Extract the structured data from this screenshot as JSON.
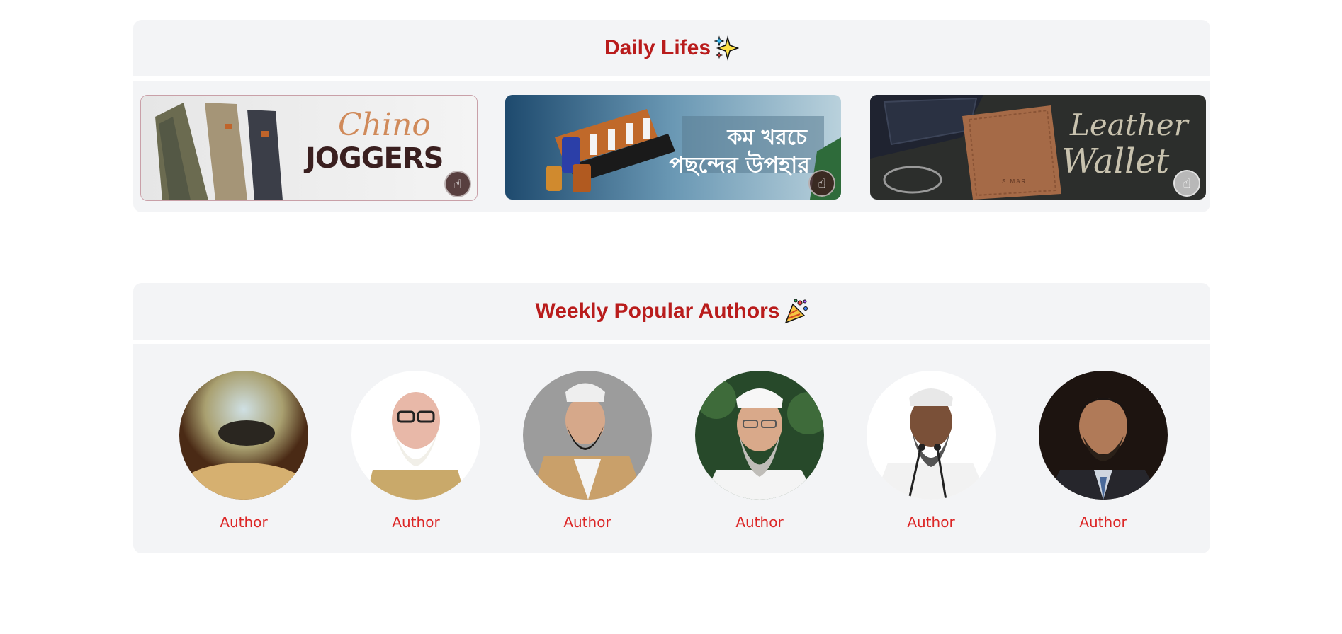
{
  "daily": {
    "title": "Daily Lifes",
    "title_icon": "sparkles-icon",
    "banners": [
      {
        "line1": "Chino",
        "line2": "JOGGERS",
        "badge_icon": "hand-pointer-icon"
      },
      {
        "line1": "কম খরচে",
        "line2": "পছন্দের উপহার",
        "badge_icon": "hand-pointer-icon"
      },
      {
        "line1": "Leather",
        "line2": "Wallet",
        "brand": "SIMAR",
        "badge_icon": "hand-pointer-icon"
      }
    ]
  },
  "authors": {
    "title": "Weekly Popular Authors",
    "title_icon": "party-popper-icon",
    "items": [
      {
        "name": "Author"
      },
      {
        "name": "Author"
      },
      {
        "name": "Author"
      },
      {
        "name": "Author"
      },
      {
        "name": "Author"
      },
      {
        "name": "Author"
      }
    ]
  },
  "colors": {
    "accent": "#b91c1c",
    "author_text": "#dc2626",
    "panel": "#f3f4f6"
  }
}
